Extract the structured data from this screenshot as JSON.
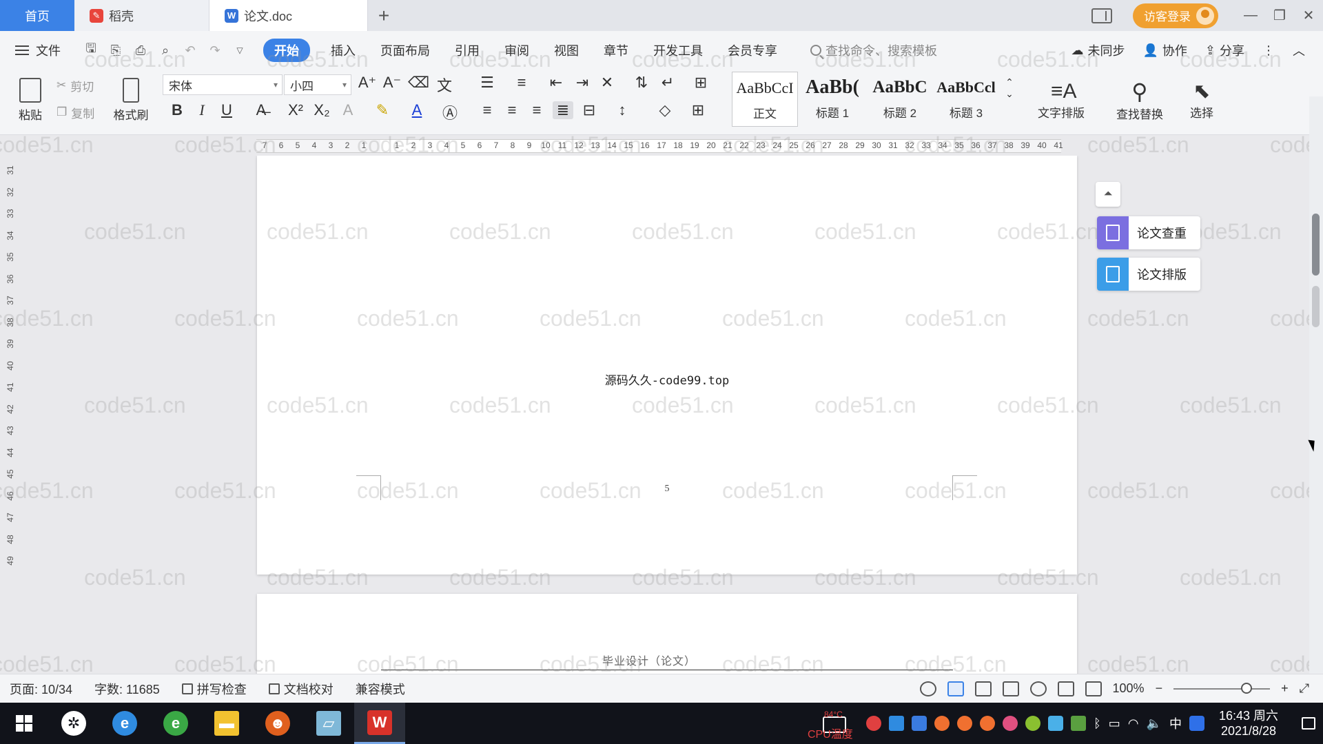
{
  "tabs": {
    "home": "首页",
    "daoke": "稻壳",
    "doc": "论文.doc",
    "add": "+"
  },
  "window": {
    "login": "访客登录",
    "minimize": "—",
    "restore": "❐",
    "close": "✕"
  },
  "menu": {
    "file": "文件",
    "items": [
      "开始",
      "插入",
      "页面布局",
      "引用",
      "审阅",
      "视图",
      "章节",
      "开发工具",
      "会员专享"
    ],
    "search_placeholder": "查找命令、搜索模板",
    "unsync": "未同步",
    "collab": "协作",
    "share": "分享"
  },
  "ribbon": {
    "paste": "粘贴",
    "cut": "剪切",
    "copy": "复制",
    "format_painter": "格式刷",
    "font_name": "宋体",
    "font_size": "小四",
    "styles": [
      {
        "sample": "AaBbCcI",
        "name": "正文"
      },
      {
        "sample": "AaBb(",
        "name": "标题 1"
      },
      {
        "sample": "AaBbC",
        "name": "标题 2"
      },
      {
        "sample": "AaBbCcl",
        "name": "标题 3"
      }
    ],
    "text_layout": "文字排版",
    "find_replace": "查找替换",
    "select": "选择"
  },
  "ruler": {
    "numbers": [
      "7",
      "6",
      "5",
      "4",
      "3",
      "2",
      "1",
      "",
      "1",
      "2",
      "3",
      "4",
      "5",
      "6",
      "7",
      "8",
      "9",
      "10",
      "11",
      "12",
      "13",
      "14",
      "15",
      "16",
      "17",
      "18",
      "19",
      "20",
      "21",
      "22",
      "23",
      "24",
      "25",
      "26",
      "27",
      "28",
      "29",
      "30",
      "31",
      "32",
      "33",
      "34",
      "35",
      "36",
      "37",
      "38",
      "39",
      "40",
      "41"
    ],
    "vertical": [
      "31",
      "32",
      "33",
      "34",
      "35",
      "36",
      "37",
      "38",
      "39",
      "40",
      "41",
      "42",
      "43",
      "44",
      "45",
      "46",
      "47",
      "48",
      "49"
    ]
  },
  "document": {
    "body_text": "源码久久-code99.top",
    "page_number": "5",
    "next_header": "毕业设计（论文）",
    "watermark": "code51.cn"
  },
  "side_panel": {
    "check": "论文查重",
    "layout": "论文排版",
    "check_color": "#7b6fe0",
    "layout_color": "#3b9de8"
  },
  "status": {
    "page": "页面: 10/34",
    "words": "字数: 11685",
    "spell": "拼写检查",
    "proof": "文档校对",
    "compat": "兼容模式",
    "zoom": "100%"
  },
  "taskbar": {
    "cpu_temp": "84°C",
    "cpu_label": "CPU温度",
    "ime": "中",
    "time": "16:43 周六",
    "date": "2021/8/28"
  }
}
